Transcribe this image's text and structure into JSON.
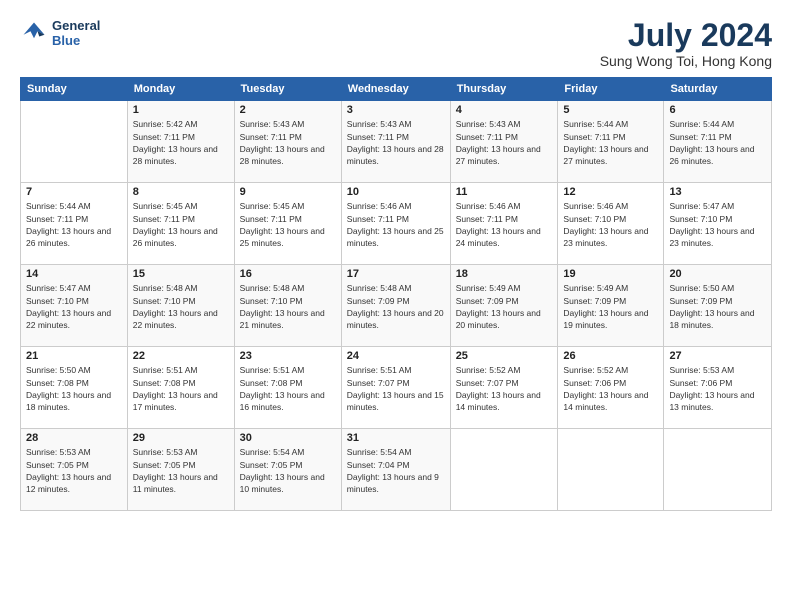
{
  "header": {
    "logo_line1": "General",
    "logo_line2": "Blue",
    "month": "July 2024",
    "location": "Sung Wong Toi, Hong Kong"
  },
  "weekdays": [
    "Sunday",
    "Monday",
    "Tuesday",
    "Wednesday",
    "Thursday",
    "Friday",
    "Saturday"
  ],
  "weeks": [
    [
      {
        "day": "",
        "sunrise": "",
        "sunset": "",
        "daylight": ""
      },
      {
        "day": "1",
        "sunrise": "5:42 AM",
        "sunset": "7:11 PM",
        "daylight": "13 hours and 28 minutes."
      },
      {
        "day": "2",
        "sunrise": "5:43 AM",
        "sunset": "7:11 PM",
        "daylight": "13 hours and 28 minutes."
      },
      {
        "day": "3",
        "sunrise": "5:43 AM",
        "sunset": "7:11 PM",
        "daylight": "13 hours and 28 minutes."
      },
      {
        "day": "4",
        "sunrise": "5:43 AM",
        "sunset": "7:11 PM",
        "daylight": "13 hours and 27 minutes."
      },
      {
        "day": "5",
        "sunrise": "5:44 AM",
        "sunset": "7:11 PM",
        "daylight": "13 hours and 27 minutes."
      },
      {
        "day": "6",
        "sunrise": "5:44 AM",
        "sunset": "7:11 PM",
        "daylight": "13 hours and 26 minutes."
      }
    ],
    [
      {
        "day": "7",
        "sunrise": "5:44 AM",
        "sunset": "7:11 PM",
        "daylight": "13 hours and 26 minutes."
      },
      {
        "day": "8",
        "sunrise": "5:45 AM",
        "sunset": "7:11 PM",
        "daylight": "13 hours and 26 minutes."
      },
      {
        "day": "9",
        "sunrise": "5:45 AM",
        "sunset": "7:11 PM",
        "daylight": "13 hours and 25 minutes."
      },
      {
        "day": "10",
        "sunrise": "5:46 AM",
        "sunset": "7:11 PM",
        "daylight": "13 hours and 25 minutes."
      },
      {
        "day": "11",
        "sunrise": "5:46 AM",
        "sunset": "7:11 PM",
        "daylight": "13 hours and 24 minutes."
      },
      {
        "day": "12",
        "sunrise": "5:46 AM",
        "sunset": "7:10 PM",
        "daylight": "13 hours and 23 minutes."
      },
      {
        "day": "13",
        "sunrise": "5:47 AM",
        "sunset": "7:10 PM",
        "daylight": "13 hours and 23 minutes."
      }
    ],
    [
      {
        "day": "14",
        "sunrise": "5:47 AM",
        "sunset": "7:10 PM",
        "daylight": "13 hours and 22 minutes."
      },
      {
        "day": "15",
        "sunrise": "5:48 AM",
        "sunset": "7:10 PM",
        "daylight": "13 hours and 22 minutes."
      },
      {
        "day": "16",
        "sunrise": "5:48 AM",
        "sunset": "7:10 PM",
        "daylight": "13 hours and 21 minutes."
      },
      {
        "day": "17",
        "sunrise": "5:48 AM",
        "sunset": "7:09 PM",
        "daylight": "13 hours and 20 minutes."
      },
      {
        "day": "18",
        "sunrise": "5:49 AM",
        "sunset": "7:09 PM",
        "daylight": "13 hours and 20 minutes."
      },
      {
        "day": "19",
        "sunrise": "5:49 AM",
        "sunset": "7:09 PM",
        "daylight": "13 hours and 19 minutes."
      },
      {
        "day": "20",
        "sunrise": "5:50 AM",
        "sunset": "7:09 PM",
        "daylight": "13 hours and 18 minutes."
      }
    ],
    [
      {
        "day": "21",
        "sunrise": "5:50 AM",
        "sunset": "7:08 PM",
        "daylight": "13 hours and 18 minutes."
      },
      {
        "day": "22",
        "sunrise": "5:51 AM",
        "sunset": "7:08 PM",
        "daylight": "13 hours and 17 minutes."
      },
      {
        "day": "23",
        "sunrise": "5:51 AM",
        "sunset": "7:08 PM",
        "daylight": "13 hours and 16 minutes."
      },
      {
        "day": "24",
        "sunrise": "5:51 AM",
        "sunset": "7:07 PM",
        "daylight": "13 hours and 15 minutes."
      },
      {
        "day": "25",
        "sunrise": "5:52 AM",
        "sunset": "7:07 PM",
        "daylight": "13 hours and 14 minutes."
      },
      {
        "day": "26",
        "sunrise": "5:52 AM",
        "sunset": "7:06 PM",
        "daylight": "13 hours and 14 minutes."
      },
      {
        "day": "27",
        "sunrise": "5:53 AM",
        "sunset": "7:06 PM",
        "daylight": "13 hours and 13 minutes."
      }
    ],
    [
      {
        "day": "28",
        "sunrise": "5:53 AM",
        "sunset": "7:05 PM",
        "daylight": "13 hours and 12 minutes."
      },
      {
        "day": "29",
        "sunrise": "5:53 AM",
        "sunset": "7:05 PM",
        "daylight": "13 hours and 11 minutes."
      },
      {
        "day": "30",
        "sunrise": "5:54 AM",
        "sunset": "7:05 PM",
        "daylight": "13 hours and 10 minutes."
      },
      {
        "day": "31",
        "sunrise": "5:54 AM",
        "sunset": "7:04 PM",
        "daylight": "13 hours and 9 minutes."
      },
      {
        "day": "",
        "sunrise": "",
        "sunset": "",
        "daylight": ""
      },
      {
        "day": "",
        "sunrise": "",
        "sunset": "",
        "daylight": ""
      },
      {
        "day": "",
        "sunrise": "",
        "sunset": "",
        "daylight": ""
      }
    ]
  ]
}
